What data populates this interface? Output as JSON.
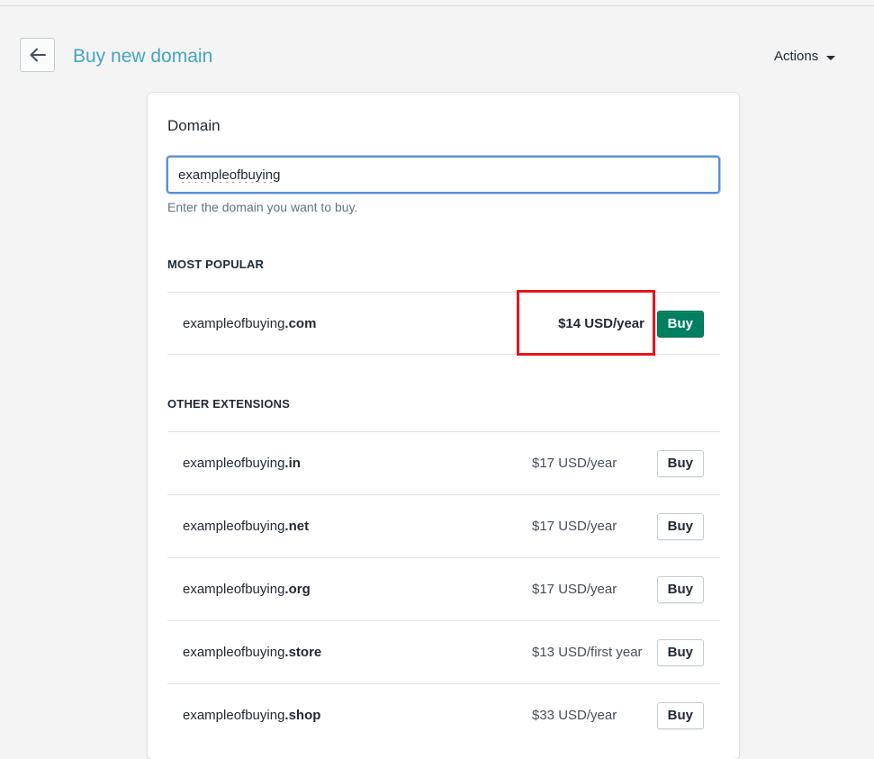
{
  "header": {
    "back_icon": "arrow-left-icon",
    "title": "Buy new domain",
    "actions_label": "Actions",
    "actions_icon": "caret-down-icon"
  },
  "domain_card": {
    "heading": "Domain",
    "input_value": "exampleofbuying",
    "help_text": "Enter the domain you want to buy."
  },
  "most_popular": {
    "heading": "MOST POPULAR",
    "items": [
      {
        "name": "exampleofbuying",
        "tld": ".com",
        "price": "$14 USD/year",
        "buy_label": "Buy"
      }
    ]
  },
  "other_extensions": {
    "heading": "OTHER EXTENSIONS",
    "items": [
      {
        "name": "exampleofbuying",
        "tld": ".in",
        "price": "$17 USD/year",
        "buy_label": "Buy"
      },
      {
        "name": "exampleofbuying",
        "tld": ".net",
        "price": "$17 USD/year",
        "buy_label": "Buy"
      },
      {
        "name": "exampleofbuying",
        "tld": ".org",
        "price": "$17 USD/year",
        "buy_label": "Buy"
      },
      {
        "name": "exampleofbuying",
        "tld": ".store",
        "price": "$13 USD/first year",
        "buy_label": "Buy"
      },
      {
        "name": "exampleofbuying",
        "tld": ".shop",
        "price": "$33 USD/year",
        "buy_label": "Buy"
      }
    ]
  },
  "colors": {
    "title": "#44a5c2",
    "primary_button": "#018060",
    "highlight": "#e8141b"
  }
}
